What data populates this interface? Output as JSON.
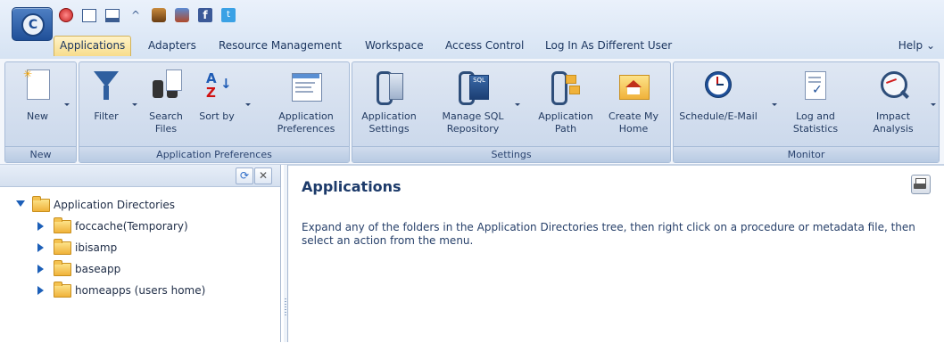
{
  "menu": {
    "items": [
      "Applications",
      "Adapters",
      "Resource Management",
      "Workspace",
      "Access Control",
      "Log In As Different User"
    ],
    "help": "Help ⌄"
  },
  "ribbon": {
    "groups": [
      {
        "label": "New",
        "buttons": [
          {
            "label": "New",
            "icon": "new-document-icon"
          }
        ]
      },
      {
        "label": "Application Preferences",
        "buttons": [
          {
            "label": "Filter",
            "icon": "filter-icon"
          },
          {
            "label": "Search Files",
            "icon": "binoculars-icon"
          },
          {
            "label": "Sort by",
            "icon": "sort-az-icon"
          },
          {
            "label": "Application Preferences",
            "icon": "preferences-window-icon"
          }
        ]
      },
      {
        "label": "Settings",
        "buttons": [
          {
            "label": "Application Settings",
            "icon": "settings-icon"
          },
          {
            "label": "Manage SQL Repository",
            "icon": "sql-repository-icon"
          },
          {
            "label": "Application Path",
            "icon": "path-icon"
          },
          {
            "label": "Create My Home",
            "icon": "home-icon"
          }
        ]
      },
      {
        "label": "Monitor",
        "buttons": [
          {
            "label": "Schedule/E-Mail",
            "icon": "clock-icon"
          },
          {
            "label": "Log and Statistics",
            "icon": "log-icon"
          },
          {
            "label": "Impact Analysis",
            "icon": "magnifier-chart-icon"
          }
        ]
      }
    ]
  },
  "tree": {
    "root": "Application Directories",
    "children": [
      "foccache(Temporary)",
      "ibisamp",
      "baseapp",
      "homeapps (users home)"
    ]
  },
  "main": {
    "title": "Applications",
    "text": "Expand any of the folders in the Application Directories tree, then right click on a procedure or metadata file, then select an action from the menu."
  },
  "colors": {
    "accent": "#1c5fb8",
    "active_tab": "#f7dc8c",
    "folder": "#f0b23a"
  }
}
